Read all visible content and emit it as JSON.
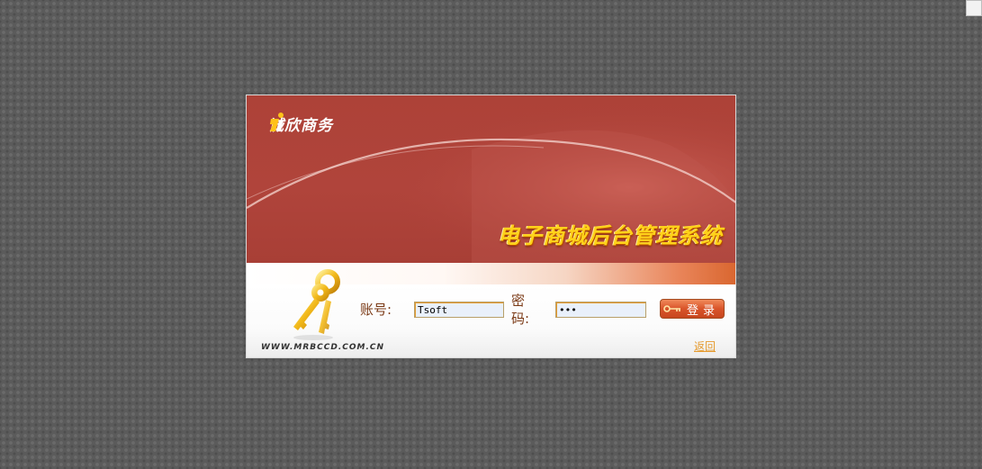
{
  "brand": {
    "name": "诚欣商务",
    "logo_icon": "brand-logo-icon"
  },
  "banner": {
    "system_title": "电子商城后台管理系统"
  },
  "form": {
    "account_label": "账号:",
    "account_value": "Tsoft",
    "password_label": "密码:",
    "password_value": "123",
    "login_button_label": "登录",
    "login_button_icon": "key-icon"
  },
  "footer": {
    "site_url": "WWW.MRBCCD.COM.CN",
    "back_link": "返回"
  },
  "colors": {
    "banner_red": "#ad4238",
    "title_yellow": "#ffd21a",
    "label_brown": "#7b3a16",
    "button_orange": "#d9542a",
    "link_orange": "#e59a2e"
  }
}
